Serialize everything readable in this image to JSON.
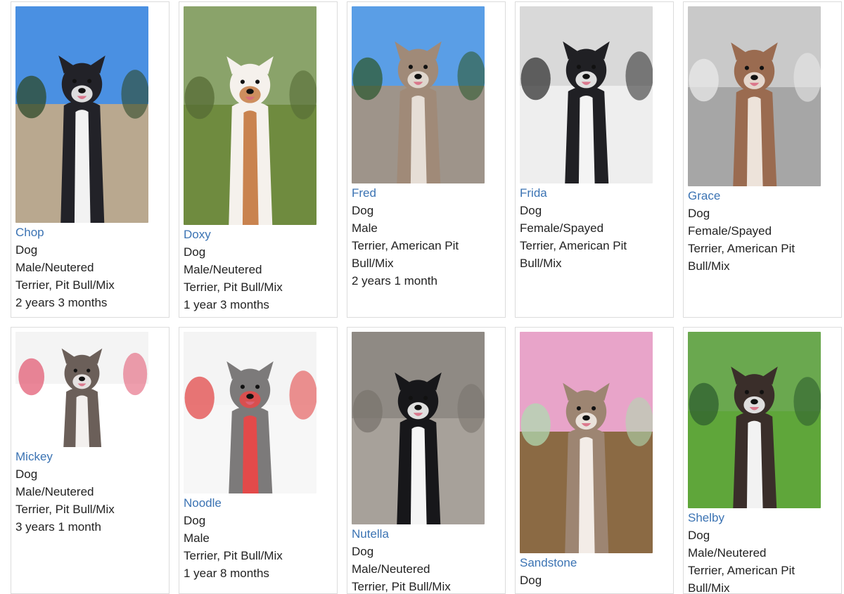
{
  "pets": [
    {
      "name": "Chop",
      "species": "Dog",
      "sex": "Male/Neutered",
      "breed": "Terrier, Pit Bull/Mix",
      "age": "2 years 3 months",
      "photo_icon": "dog-photo",
      "colors": {
        "sky": "#4a90e2",
        "ground": "#b9a88f",
        "fur": "#222228",
        "chest": "#f2f2f2",
        "tree": "#2e4a2a"
      }
    },
    {
      "name": "Doxy",
      "species": "Dog",
      "sex": "Male/Neutered",
      "breed": "Terrier, Pit Bull/Mix",
      "age": "1 year 3 months",
      "photo_icon": "dog-photo",
      "colors": {
        "sky": "#8aa36a",
        "ground": "#6f8b3f",
        "fur": "#f5f1ec",
        "chest": "#c9834f",
        "tree": "#556b36"
      }
    },
    {
      "name": "Fred",
      "species": "Dog",
      "sex": "Male",
      "breed": "Terrier, American Pit Bull/Mix",
      "age": "2 years 1 month",
      "photo_icon": "dog-photo",
      "colors": {
        "sky": "#5a9ee6",
        "ground": "#9e948a",
        "fur": "#a08a78",
        "chest": "#e6ded6",
        "tree": "#2f5a31"
      }
    },
    {
      "name": "Frida",
      "species": "Dog",
      "sex": "Female/Spayed",
      "breed": "Terrier, American Pit Bull/Mix",
      "age": "",
      "photo_icon": "dog-photo",
      "colors": {
        "sky": "#d9d9d9",
        "ground": "#eeeeee",
        "fur": "#202024",
        "chest": "#f4f4f4",
        "tree": "#333333"
      }
    },
    {
      "name": "Grace",
      "species": "Dog",
      "sex": "Female/Spayed",
      "breed": "Terrier, American Pit Bull/Mix",
      "age": "",
      "photo_icon": "dog-photo",
      "colors": {
        "sky": "#c9c9c9",
        "ground": "#a6a6a6",
        "fur": "#9a6b50",
        "chest": "#ede3da",
        "tree": "#e8e8e8"
      }
    },
    {
      "name": "Mickey",
      "species": "Dog",
      "sex": "Male/Neutered",
      "breed": "Terrier, Pit Bull/Mix",
      "age": "3 years 1 month",
      "photo_icon": "dog-photo",
      "colors": {
        "sky": "#f4f4f4",
        "ground": "#ffffff",
        "fur": "#6b5f59",
        "chest": "#f3f0ee",
        "tree": "#e35d76"
      }
    },
    {
      "name": "Noodle",
      "species": "Dog",
      "sex": "Male",
      "breed": "Terrier, Pit Bull/Mix",
      "age": "1 year 8 months",
      "photo_icon": "dog-photo",
      "colors": {
        "sky": "#f4f4f4",
        "ground": "#f7f7f7",
        "fur": "#7c7a7a",
        "chest": "#e34a4a",
        "tree": "#e34a4a"
      }
    },
    {
      "name": "Nutella",
      "species": "Dog",
      "sex": "Male/Neutered",
      "breed": "Terrier, Pit Bull/Mix",
      "age": "",
      "photo_icon": "dog-photo",
      "colors": {
        "sky": "#8f8a84",
        "ground": "#a7a19a",
        "fur": "#17171a",
        "chest": "#f5f5f5",
        "tree": "#7a746e"
      }
    },
    {
      "name": "Sandstone",
      "species": "Dog",
      "sex": "",
      "breed": "",
      "age": "",
      "photo_icon": "dog-photo",
      "colors": {
        "sky": "#e8a4c9",
        "ground": "#8b6a44",
        "fur": "#9d8572",
        "chest": "#f3ece7",
        "tree": "#b0d9b0"
      }
    },
    {
      "name": "Shelby",
      "species": "Dog",
      "sex": "Male/Neutered",
      "breed": "Terrier, American Pit Bull/Mix",
      "age": "",
      "photo_icon": "dog-photo",
      "colors": {
        "sky": "#6aa84f",
        "ground": "#5fa63a",
        "fur": "#3a2e2a",
        "chest": "#f2f2f2",
        "tree": "#2f5f2f"
      }
    }
  ]
}
